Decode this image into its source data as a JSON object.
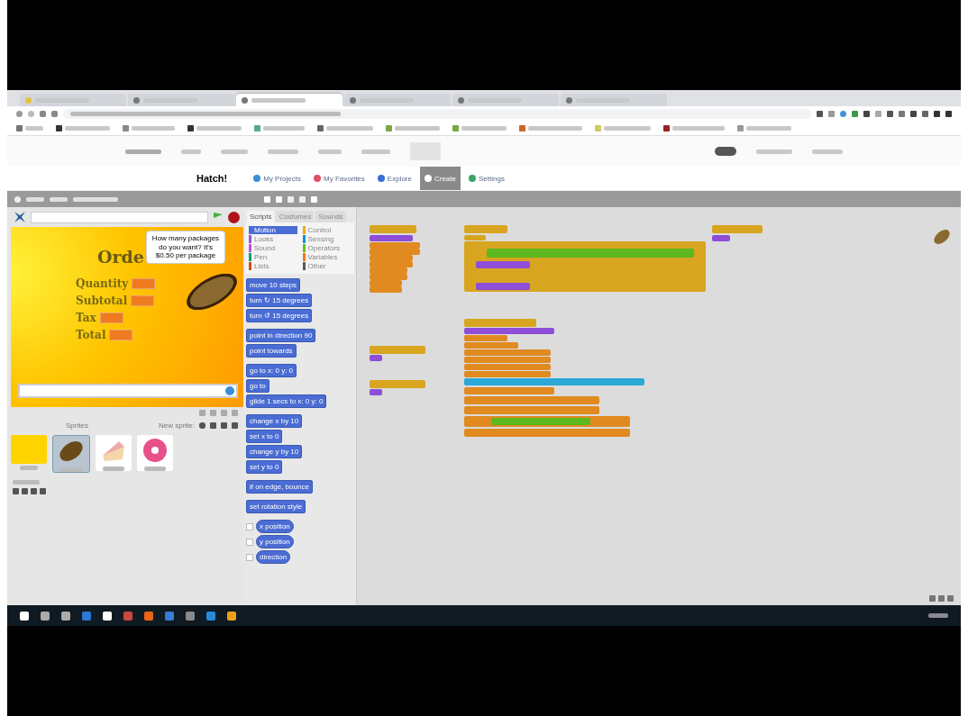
{
  "browser_tabs": [
    {
      "selected": false
    },
    {
      "selected": false
    },
    {
      "selected": true
    },
    {
      "selected": false
    },
    {
      "selected": false
    },
    {
      "selected": false
    }
  ],
  "site": {
    "title": "Hatch!",
    "nav": [
      {
        "label": "My Projects",
        "color": "#3a8fd6",
        "selected": false
      },
      {
        "label": "My Favorites",
        "color": "#e0506a",
        "selected": false
      },
      {
        "label": "Explore",
        "color": "#3a6fd6",
        "selected": false
      },
      {
        "label": "Create",
        "color": "#ffffff",
        "selected": true
      },
      {
        "label": "Settings",
        "color": "#3aa36a",
        "selected": false
      }
    ]
  },
  "palette": {
    "tabs": [
      {
        "label": "Scripts",
        "selected": true
      },
      {
        "label": "Costumes",
        "selected": false
      },
      {
        "label": "Sounds",
        "selected": false
      }
    ],
    "categories": [
      {
        "label": "Motion",
        "color": "#4a6cd4",
        "selected": true
      },
      {
        "label": "Control",
        "color": "#e6a822",
        "selected": false
      },
      {
        "label": "Looks",
        "color": "#8f56e3",
        "selected": false
      },
      {
        "label": "Sensing",
        "color": "#0494dc",
        "selected": false
      },
      {
        "label": "Sound",
        "color": "#cf4ad9",
        "selected": false
      },
      {
        "label": "Operators",
        "color": "#62c213",
        "selected": false
      },
      {
        "label": "Pen",
        "color": "#00a178",
        "selected": false
      },
      {
        "label": "Variables",
        "color": "#f3761d",
        "selected": false
      },
      {
        "label": "Lists",
        "color": "#d94d11",
        "selected": false
      },
      {
        "label": "Other",
        "color": "#5a5a5a",
        "selected": false
      }
    ],
    "block_groups": [
      {
        "blocks": [
          {
            "label": "move 10 steps",
            "kind": "command"
          },
          {
            "label": "turn ↻ 15 degrees",
            "kind": "command"
          },
          {
            "label": "turn ↺ 15 degrees",
            "kind": "command"
          }
        ]
      },
      {
        "blocks": [
          {
            "label": "point in direction 90",
            "kind": "command"
          },
          {
            "label": "point towards",
            "kind": "command"
          }
        ]
      },
      {
        "blocks": [
          {
            "label": "go to x: 0 y: 0",
            "kind": "command"
          },
          {
            "label": "go to",
            "kind": "command"
          },
          {
            "label": "glide 1 secs to x: 0 y: 0",
            "kind": "command"
          }
        ]
      },
      {
        "blocks": [
          {
            "label": "change x by 10",
            "kind": "command"
          },
          {
            "label": "set x to 0",
            "kind": "command"
          },
          {
            "label": "change y by 10",
            "kind": "command"
          },
          {
            "label": "set y to 0",
            "kind": "command"
          }
        ]
      },
      {
        "blocks": [
          {
            "label": "if on edge, bounce",
            "kind": "command"
          }
        ]
      },
      {
        "blocks": [
          {
            "label": "set rotation style",
            "kind": "command"
          }
        ]
      },
      {
        "blocks": [
          {
            "label": "x position",
            "kind": "reporter",
            "checked": false
          },
          {
            "label": "y position",
            "kind": "reporter",
            "checked": false
          },
          {
            "label": "direction",
            "kind": "reporter",
            "checked": false
          }
        ]
      }
    ]
  },
  "stage": {
    "heading": "Orde",
    "speech": "How many packages do you want? It's $0.50 per package",
    "readouts": [
      {
        "label": "Quantity"
      },
      {
        "label": "Subtotal"
      },
      {
        "label": "Tax"
      },
      {
        "label": "Total"
      }
    ]
  },
  "corral": {
    "header": "Sprites",
    "new_sprite": "New sprite:",
    "sprites": [
      {
        "kind": "bread",
        "selected": true
      },
      {
        "kind": "cake",
        "selected": false
      },
      {
        "kind": "donut",
        "selected": false
      }
    ]
  }
}
